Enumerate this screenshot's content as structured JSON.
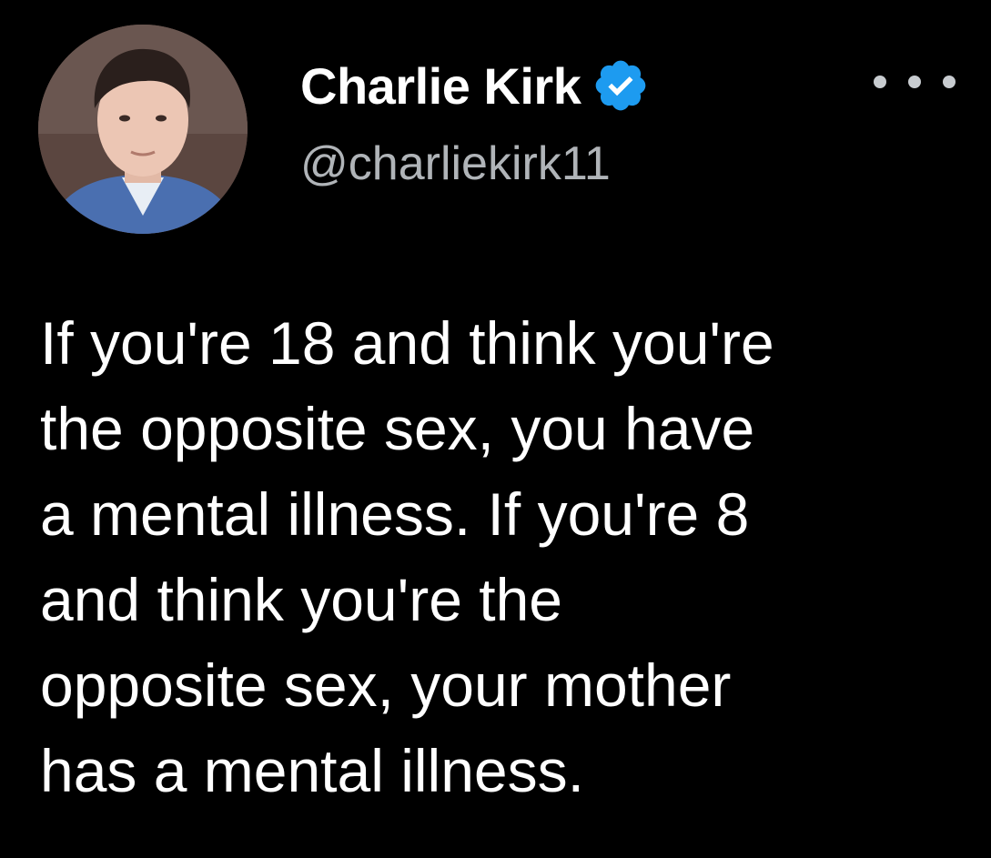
{
  "tweet": {
    "author": {
      "display_name": "Charlie Kirk",
      "handle": "@charliekirk11",
      "verified": true,
      "verified_badge_color": "#1d9bf0",
      "avatar_icon": "profile-photo"
    },
    "more_icon": "more-horizontal-icon",
    "text_lines": [
      "If you're 18 and think you're",
      "the opposite sex, you have",
      "a mental illness. If you're 8",
      "and think you're the",
      "opposite sex, your mother",
      "has a mental illness."
    ]
  },
  "colors": {
    "background": "#000000",
    "primary_text": "#ffffff",
    "secondary_text": "#b0b4b8"
  }
}
